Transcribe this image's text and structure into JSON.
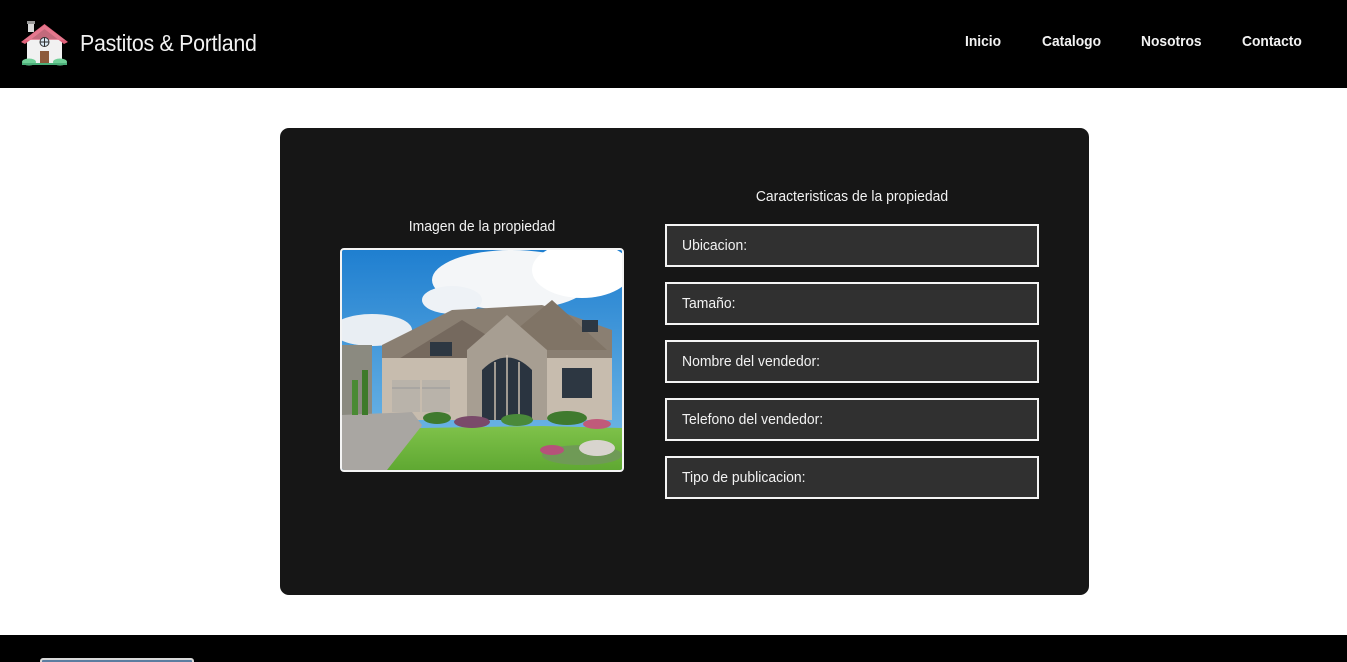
{
  "header": {
    "brand_name": "Pastitos & Portland",
    "nav": [
      "Inicio",
      "Catalogo",
      "Nosotros",
      "Contacto"
    ]
  },
  "card": {
    "image_title": "Imagen de la propiedad",
    "features_title": "Caracteristicas de la propiedad",
    "fields": [
      "Ubicacion:",
      "Tamaño:",
      "Nombre del vendedor:",
      "Telefono del vendedor:",
      "Tipo de publicacion:"
    ]
  },
  "colors": {
    "navbar_bg": "#000000",
    "card_bg": "#161616",
    "field_bg": "#303030",
    "field_border": "#f4f4f4",
    "text": "#f2f2f2",
    "page_bg": "#ffffff"
  },
  "icons": {
    "brand_logo": "house-logo-icon"
  }
}
